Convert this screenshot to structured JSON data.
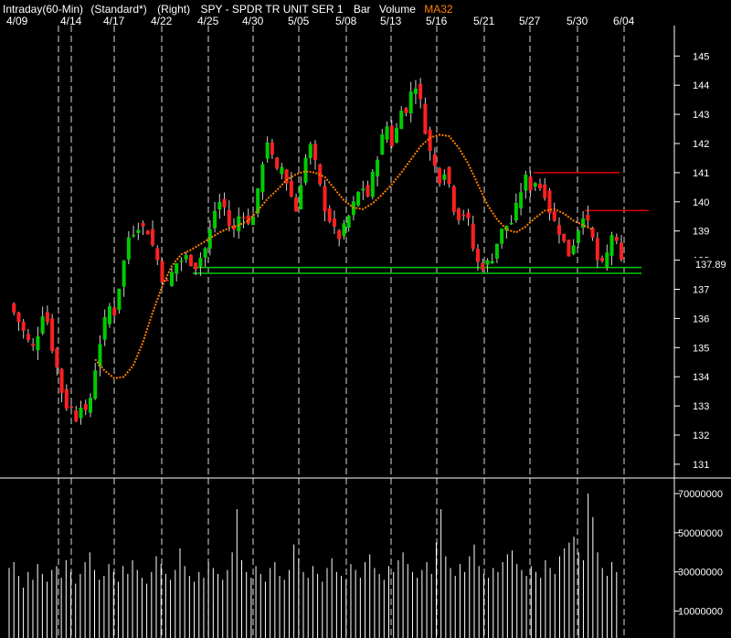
{
  "header": {
    "interval": "Intraday(60-Min)",
    "scale": "(Standard*)",
    "axis_side": "(Right)",
    "symbol": "SPY - SPDR TR UNIT SER 1",
    "chart_style": "Bar",
    "volume_label": "Volume",
    "ma_label": "MA32"
  },
  "colors": {
    "background": "#000000",
    "up_bar": "#00cc00",
    "down_bar": "#ff2020",
    "ma_line": "#ff7f00",
    "support_line": "#00cc00",
    "resistance_line": "#e00000",
    "grid": "#ffffff",
    "volume_bar": "#ffffff",
    "text": "#ffffff"
  },
  "chart_data": [
    {
      "type": "candlestick",
      "title": "",
      "x_labels": [
        "4/09",
        "4/14",
        "4/17",
        "4/22",
        "4/25",
        "4/30",
        "5/05",
        "5/08",
        "5/13",
        "5/16",
        "5/21",
        "5/27",
        "5/30",
        "6/04"
      ],
      "y_ticks": [
        131,
        132,
        133,
        134,
        135,
        136,
        137,
        138,
        139,
        140,
        141,
        142,
        143,
        144,
        145
      ],
      "ylim": [
        130.7,
        145.6
      ],
      "last_price": "137.89",
      "grid": "vertical dashed at date labels",
      "close_path": [
        [
          0,
          136.5
        ],
        [
          2,
          135.9
        ],
        [
          4,
          135.2
        ],
        [
          5,
          135.0
        ],
        [
          6,
          135.5
        ],
        [
          7,
          136.2
        ],
        [
          8,
          135.9
        ],
        [
          9,
          135.0
        ],
        [
          10,
          134.3
        ],
        [
          11,
          133.5
        ],
        [
          12,
          133.0
        ],
        [
          13,
          132.9
        ],
        [
          14,
          132.6
        ],
        [
          15,
          133.1
        ],
        [
          16,
          132.7
        ],
        [
          17,
          133.3
        ],
        [
          18,
          134.3
        ],
        [
          19,
          135.2
        ],
        [
          20,
          135.9
        ],
        [
          21,
          136.4
        ],
        [
          22,
          136.2
        ],
        [
          23,
          137.1
        ],
        [
          25,
          138.8
        ],
        [
          27,
          139.2
        ],
        [
          29,
          139.0
        ],
        [
          30,
          138.5
        ],
        [
          31,
          138.0
        ],
        [
          32,
          137.4
        ],
        [
          33,
          137.2
        ],
        [
          35,
          137.9
        ],
        [
          37,
          138.1
        ],
        [
          39,
          137.8
        ],
        [
          41,
          138.4
        ],
        [
          42,
          139.0
        ],
        [
          43,
          139.7
        ],
        [
          44,
          140.0
        ],
        [
          45,
          139.8
        ],
        [
          46,
          139.2
        ],
        [
          47,
          139.0
        ],
        [
          48,
          139.5
        ],
        [
          49,
          139.6
        ],
        [
          50,
          139.2
        ],
        [
          51,
          139.6
        ],
        [
          52,
          140.3
        ],
        [
          53,
          141.4
        ],
        [
          54,
          142.1
        ],
        [
          55,
          141.5
        ],
        [
          56,
          141.0
        ],
        [
          57,
          141.2
        ],
        [
          58,
          140.7
        ],
        [
          59,
          140.2
        ],
        [
          60,
          139.7
        ],
        [
          61,
          140.7
        ],
        [
          62,
          141.5
        ],
        [
          63,
          141.9
        ],
        [
          64,
          141.3
        ],
        [
          65,
          140.5
        ],
        [
          66,
          139.8
        ],
        [
          67,
          139.4
        ],
        [
          68,
          139.0
        ],
        [
          69,
          138.8
        ],
        [
          70,
          139.1
        ],
        [
          71,
          139.5
        ],
        [
          72,
          139.9
        ],
        [
          73,
          140.3
        ],
        [
          74,
          140.5
        ],
        [
          75,
          140.2
        ],
        [
          76,
          140.9
        ],
        [
          77,
          141.6
        ],
        [
          78,
          142.2
        ],
        [
          79,
          142.6
        ],
        [
          80,
          142.0
        ],
        [
          81,
          142.5
        ],
        [
          82,
          143.3
        ],
        [
          83,
          143.0
        ],
        [
          84,
          143.8
        ],
        [
          85,
          144.0
        ],
        [
          86,
          143.4
        ],
        [
          87,
          142.5
        ],
        [
          88,
          141.7
        ],
        [
          89,
          141.2
        ],
        [
          90,
          140.8
        ],
        [
          91,
          141.1
        ],
        [
          92,
          140.6
        ],
        [
          93,
          139.8
        ],
        [
          94,
          139.5
        ],
        [
          95,
          139.6
        ],
        [
          96,
          139.3
        ],
        [
          97,
          138.4
        ],
        [
          98,
          137.9
        ],
        [
          99,
          137.8
        ],
        [
          100,
          137.9
        ],
        [
          101,
          138.1
        ],
        [
          102,
          138.6
        ],
        [
          103,
          139.0
        ],
        [
          104,
          139.2
        ],
        [
          105,
          139.3
        ],
        [
          106,
          139.8
        ],
        [
          107,
          140.4
        ],
        [
          108,
          140.8
        ],
        [
          109,
          140.5
        ],
        [
          110,
          140.7
        ],
        [
          111,
          140.5
        ],
        [
          112,
          140.3
        ],
        [
          113,
          139.7
        ],
        [
          114,
          139.3
        ],
        [
          115,
          139.0
        ],
        [
          116,
          138.6
        ],
        [
          117,
          138.2
        ],
        [
          118,
          138.6
        ],
        [
          119,
          139.1
        ],
        [
          120,
          139.6
        ],
        [
          121,
          139.2
        ],
        [
          122,
          138.7
        ],
        [
          123,
          138.0
        ],
        [
          124,
          137.8
        ],
        [
          125,
          138.2
        ],
        [
          126,
          138.9
        ],
        [
          127,
          138.5
        ],
        [
          128,
          137.9
        ]
      ],
      "ma32_path": [
        [
          18,
          134.6
        ],
        [
          20,
          134.2
        ],
        [
          22,
          133.95
        ],
        [
          24,
          134.0
        ],
        [
          26,
          134.4
        ],
        [
          28,
          135.2
        ],
        [
          30,
          136.2
        ],
        [
          32,
          137.1
        ],
        [
          34,
          137.8
        ],
        [
          36,
          138.2
        ],
        [
          38,
          138.35
        ],
        [
          40,
          138.55
        ],
        [
          42,
          138.75
        ],
        [
          44,
          138.95
        ],
        [
          46,
          139.1
        ],
        [
          48,
          139.2
        ],
        [
          50,
          139.35
        ],
        [
          52,
          139.7
        ],
        [
          54,
          140.1
        ],
        [
          56,
          140.4
        ],
        [
          58,
          140.75
        ],
        [
          60,
          140.95
        ],
        [
          62,
          141.05
        ],
        [
          64,
          141.0
        ],
        [
          66,
          140.85
        ],
        [
          68,
          140.45
        ],
        [
          70,
          140.05
        ],
        [
          72,
          139.8
        ],
        [
          74,
          139.75
        ],
        [
          76,
          139.95
        ],
        [
          78,
          140.25
        ],
        [
          80,
          140.6
        ],
        [
          82,
          141.0
        ],
        [
          84,
          141.45
        ],
        [
          86,
          141.9
        ],
        [
          88,
          142.2
        ],
        [
          90,
          142.3
        ],
        [
          92,
          142.25
        ],
        [
          94,
          141.85
        ],
        [
          96,
          141.3
        ],
        [
          98,
          140.6
        ],
        [
          100,
          139.9
        ],
        [
          102,
          139.4
        ],
        [
          104,
          139.05
        ],
        [
          106,
          138.95
        ],
        [
          108,
          139.15
        ],
        [
          110,
          139.45
        ],
        [
          112,
          139.7
        ],
        [
          114,
          139.75
        ],
        [
          116,
          139.6
        ],
        [
          118,
          139.35
        ],
        [
          120,
          139.2
        ],
        [
          122,
          139.05
        ]
      ],
      "support_lines": [
        137.75,
        137.55
      ],
      "resistance_lines": [
        141.0,
        139.7
      ]
    },
    {
      "type": "bar",
      "title": "",
      "series_label": "Volume",
      "y_ticks": [
        10000000,
        30000000,
        50000000,
        70000000
      ],
      "y_tick_labels": [
        "10000000",
        "30000000",
        "50000000",
        "70000000"
      ],
      "ylim": [
        0,
        75000000
      ],
      "values": [
        32000000,
        35000000,
        28000000,
        22000000,
        30000000,
        26000000,
        34000000,
        29000000,
        25000000,
        31000000,
        33000000,
        27000000,
        36000000,
        30000000,
        24000000,
        29000000,
        35000000,
        40000000,
        31000000,
        26000000,
        28000000,
        34000000,
        30000000,
        25000000,
        33000000,
        29000000,
        36000000,
        31000000,
        27000000,
        24000000,
        30000000,
        38000000,
        34000000,
        29000000,
        26000000,
        31000000,
        42000000,
        33000000,
        28000000,
        25000000,
        30000000,
        27000000,
        35000000,
        32000000,
        29000000,
        26000000,
        31000000,
        40000000,
        62000000,
        36000000,
        30000000,
        27000000,
        33000000,
        29000000,
        25000000,
        32000000,
        35000000,
        28000000,
        26000000,
        31000000,
        44000000,
        37000000,
        30000000,
        27000000,
        33000000,
        29000000,
        25000000,
        32000000,
        37000000,
        30000000,
        28000000,
        26000000,
        34000000,
        31000000,
        27000000,
        35000000,
        39000000,
        32000000,
        29000000,
        26000000,
        33000000,
        30000000,
        36000000,
        40000000,
        34000000,
        30000000,
        27000000,
        31000000,
        35000000,
        29000000,
        45000000,
        62000000,
        38000000,
        32000000,
        28000000,
        34000000,
        30000000,
        38000000,
        44000000,
        33000000,
        29000000,
        27000000,
        32000000,
        30000000,
        35000000,
        39000000,
        41000000,
        34000000,
        31000000,
        28000000,
        33000000,
        30000000,
        27000000,
        36000000,
        32000000,
        29000000,
        38000000,
        42000000,
        45000000,
        48000000,
        40000000,
        36000000,
        70000000,
        58000000,
        40000000,
        32000000,
        28000000,
        35000000,
        30000000
      ]
    }
  ]
}
